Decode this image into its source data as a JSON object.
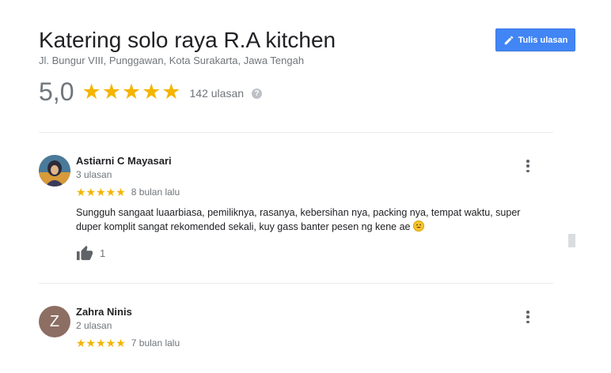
{
  "place": {
    "title": "Katering solo raya R.A kitchen",
    "address": "Jl. Bungur VIII, Punggawan, Kota Surakarta, Jawa Tengah",
    "rating": "5,0",
    "stars": "★★★★★",
    "rating_value": 5.0,
    "review_count": "142 ulasan",
    "help_icon": "?"
  },
  "actions": {
    "write_review": "Tulis ulasan"
  },
  "reviews": [
    {
      "name": "Astiarni C Mayasari",
      "sub": "3 ulasan",
      "stars": "★★★★★",
      "rating_value": 5,
      "date": "8 bulan lalu",
      "text": "Sungguh sangaat luaarbiasa, pemiliknya, rasanya, kebersihan nya, packing nya, tempat waktu, super duper komplit sangat rekomended sekali, kuy gass banter pesen ng kene ae",
      "likes": "1"
    },
    {
      "name": "Zahra Ninis",
      "initial": "Z",
      "sub": "2 ulasan",
      "stars": "★★★★★",
      "rating_value": 5,
      "date": "7 bulan lalu"
    }
  ],
  "colors": {
    "accent": "#4285f4",
    "star": "#f4b400",
    "muted": "#70757a",
    "avatar_z": "#8d6e63"
  }
}
